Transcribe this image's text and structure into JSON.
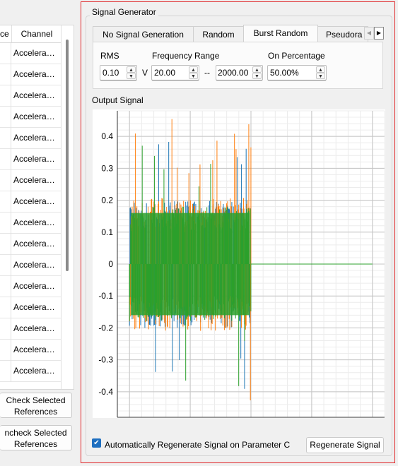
{
  "left_panel": {
    "columns": [
      "ce",
      "Channel"
    ],
    "rows": [
      "Accelera…",
      "Accelera…",
      "Accelera…",
      "Accelera…",
      "Accelera…",
      "Accelera…",
      "Accelera…",
      "Accelera…",
      "Accelera…",
      "Accelera…",
      "Accelera…",
      "Accelera…",
      "Accelera…",
      "Accelera…",
      "Accelera…",
      "Accelera…"
    ],
    "check_button": "Check Selected\nReferences",
    "uncheck_button": "ncheck Selected\nReferences"
  },
  "generator": {
    "title": "Signal Generator",
    "tabs": [
      "No Signal Generation",
      "Random",
      "Burst Random",
      "Pseudora"
    ],
    "active_tab": "Burst Random",
    "rms_label": "RMS",
    "rms_value": "0.10",
    "rms_unit": "V",
    "freq_label": "Frequency Range",
    "freq_min": "20.00",
    "freq_sep": "--",
    "freq_max": "2000.00",
    "on_label": "On Percentage",
    "on_value": "50.00%",
    "output_label": "Output Signal",
    "auto_regen_label": "Automatically Regenerate Signal on Parameter C",
    "regen_button": "Regenerate Signal"
  },
  "colors": {
    "accent": "#1e6fc0",
    "series_green": "#2ca02c",
    "series_orange": "#ff7f0e",
    "series_blue": "#1f77b4",
    "highlight_border": "#e0272a"
  },
  "chart_data": {
    "type": "line",
    "title": "",
    "xlabel": "",
    "ylabel": "",
    "xlim": [
      -0.1,
      2.1
    ],
    "ylim": [
      -0.48,
      0.48
    ],
    "x_ticks": [
      "0",
      "0.5",
      "1.0",
      "1.5",
      "2.0"
    ],
    "y_ticks": [
      "0.4",
      "0.3",
      "0.2",
      "0.1",
      "0",
      "-0.1",
      "-0.2",
      "-0.3",
      "-0.4"
    ],
    "grid": true,
    "burst_start": 0.0,
    "burst_end": 1.0,
    "envelope_typical": 0.2,
    "envelope_peak": 0.44,
    "series": [
      {
        "color": "#1f77b4",
        "x": [
          0,
          1.0,
          2.0
        ],
        "y": [
          0.0,
          0.0,
          0.0
        ]
      },
      {
        "color": "#ff7f0e",
        "x": [
          0,
          1.0,
          2.0
        ],
        "y": [
          0.0,
          0.0,
          0.0
        ]
      },
      {
        "color": "#2ca02c",
        "x": [
          0,
          1.0,
          2.0
        ],
        "y": [
          0.0,
          0.0,
          0.0
        ]
      }
    ]
  }
}
